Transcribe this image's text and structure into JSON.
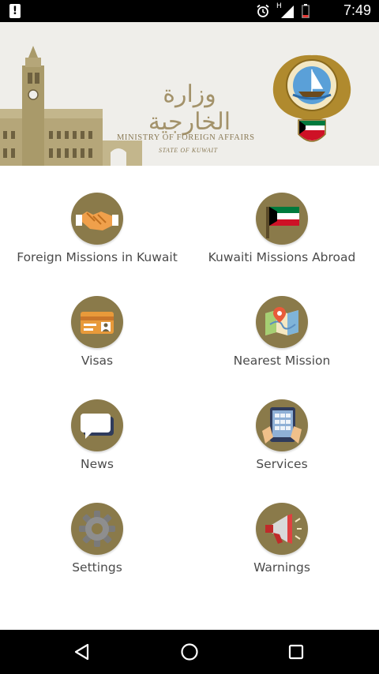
{
  "status_bar": {
    "time": "7:49",
    "network": "H"
  },
  "banner": {
    "ministry_ar": "وزارة الخارجية",
    "ministry_en": "MINISTRY OF FOREIGN AFFAIRS",
    "state_en": "STATE OF KUWAIT"
  },
  "menu": [
    {
      "label": "Foreign Missions in Kuwait",
      "icon": "handshake-icon"
    },
    {
      "label": "Kuwaiti Missions Abroad",
      "icon": "kuwait-flag-icon"
    },
    {
      "label": "Visas",
      "icon": "visa-card-icon"
    },
    {
      "label": "Nearest Mission",
      "icon": "map-pin-icon"
    },
    {
      "label": "News",
      "icon": "chat-bubbles-icon"
    },
    {
      "label": "Services",
      "icon": "tablet-icon"
    },
    {
      "label": "Settings",
      "icon": "gear-icon"
    },
    {
      "label": "Warnings",
      "icon": "megaphone-icon"
    }
  ],
  "colors": {
    "icon_circle": "#8a7a4a",
    "label_text": "#4b4b4b",
    "banner_bg": "#efeeea",
    "gold": "#8a7a56"
  }
}
